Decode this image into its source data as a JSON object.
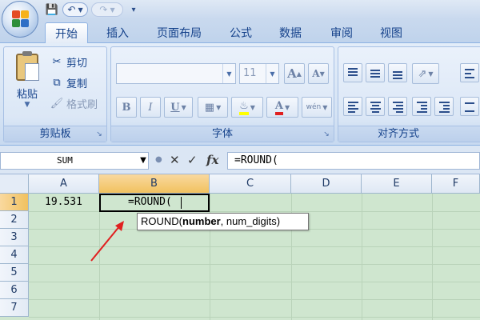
{
  "qat": {
    "save_icon": "save-icon",
    "undo_icon": "undo-icon",
    "redo_icon": "redo-icon",
    "customize_icon": "customize-qat-icon"
  },
  "tabs": [
    {
      "label": "开始",
      "active": true
    },
    {
      "label": "插入"
    },
    {
      "label": "页面布局"
    },
    {
      "label": "公式"
    },
    {
      "label": "数据"
    },
    {
      "label": "审阅"
    },
    {
      "label": "视图"
    }
  ],
  "ribbon": {
    "clipboard": {
      "group_label": "剪贴板",
      "paste_label": "粘贴",
      "cut_label": "剪切",
      "copy_label": "复制",
      "format_painter_label": "格式刷"
    },
    "font": {
      "group_label": "字体",
      "font_name": "",
      "font_size": "11",
      "grow_label": "A",
      "shrink_label": "A",
      "bold_label": "B",
      "italic_label": "I",
      "underline_label": "U",
      "font_color_label": "A",
      "phonetic_label": "wén"
    },
    "alignment": {
      "group_label": "对齐方式"
    }
  },
  "formula_bar": {
    "name_box": "SUM",
    "formula": "=ROUND(",
    "fx_label": "fx"
  },
  "grid": {
    "columns": [
      "A",
      "B",
      "C",
      "D",
      "E",
      "F"
    ],
    "rows": [
      "1",
      "2",
      "3",
      "4",
      "5",
      "6",
      "7"
    ],
    "selected_column": "B",
    "selected_row": "1",
    "cells": {
      "A1": "19.531",
      "B1": "=ROUND("
    }
  },
  "tooltip": {
    "func_name": "ROUND(",
    "arg1": "number",
    "rest": ", num_digits)"
  },
  "colors": {
    "grid_background": "#cfe6cf",
    "selected_header": "#f1c15f",
    "ribbon_text": "#15428b",
    "annotation_arrow": "#e02020"
  }
}
